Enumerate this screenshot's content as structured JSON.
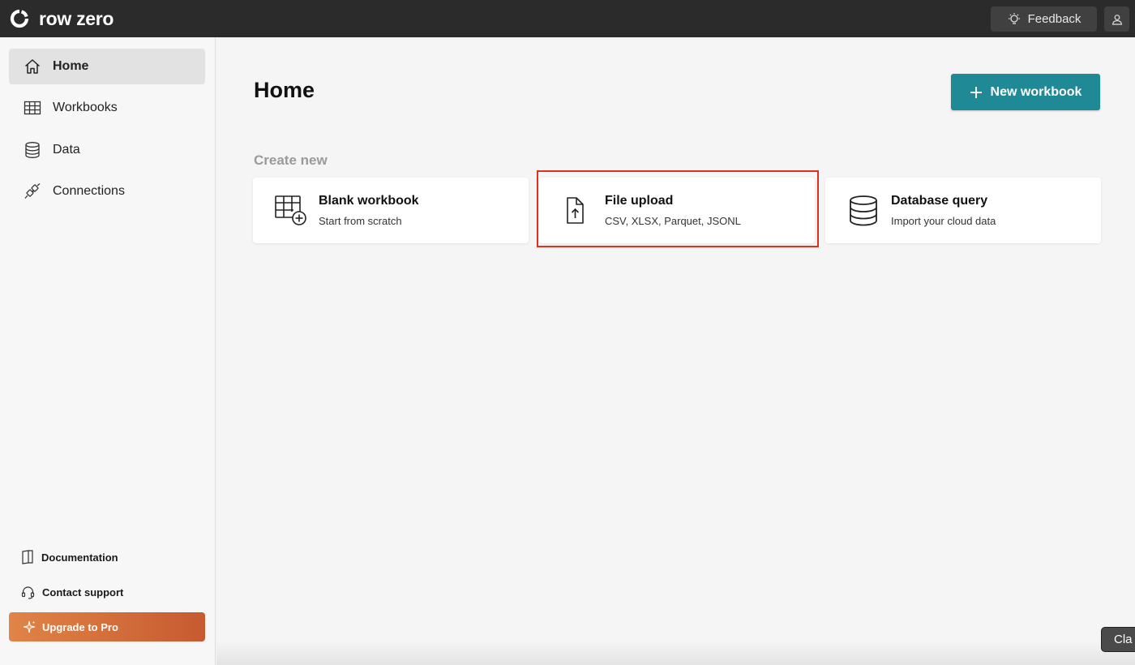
{
  "app": {
    "name": "row zero"
  },
  "topbar": {
    "feedback_label": "Feedback"
  },
  "sidebar": {
    "items": [
      {
        "label": "Home",
        "icon": "home-icon",
        "active": true
      },
      {
        "label": "Workbooks",
        "icon": "table-icon",
        "active": false
      },
      {
        "label": "Data",
        "icon": "database-icon",
        "active": false
      },
      {
        "label": "Connections",
        "icon": "plug-icon",
        "active": false
      }
    ],
    "footer": {
      "documentation_label": "Documentation",
      "support_label": "Contact support",
      "upgrade_label": "Upgrade to Pro"
    }
  },
  "main": {
    "title": "Home",
    "new_workbook_label": "New workbook",
    "section_label": "Create new",
    "cards": [
      {
        "title": "Blank workbook",
        "subtitle": "Start from scratch",
        "icon": "table-plus-icon"
      },
      {
        "title": "File upload",
        "subtitle": "CSV, XLSX, Parquet, JSONL",
        "icon": "file-upload-icon",
        "highlighted": true
      },
      {
        "title": "Database query",
        "subtitle": "Import your cloud data",
        "icon": "database-icon"
      }
    ]
  },
  "tooltip": {
    "text": "Cla"
  },
  "colors": {
    "accent": "#1f8a95",
    "highlight": "#e0301e",
    "upgrade": "#d86c3a"
  }
}
